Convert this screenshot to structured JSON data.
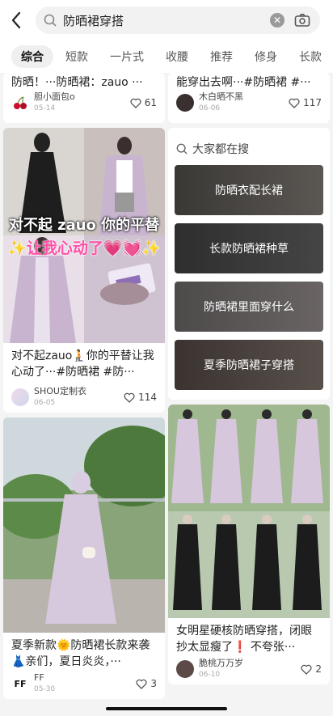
{
  "search": {
    "query": "防晒裙穿搭"
  },
  "tabs": [
    "综合",
    "短款",
    "一片式",
    "收腰",
    "推荐",
    "修身",
    "长款"
  ],
  "left_cards": [
    {
      "title": "防晒！···防晒裙：zauo ···",
      "author": "胆小面包o",
      "date": "05-14",
      "likes": "61"
    },
    {
      "title": "对不起zauo🧎你的平替让我心动了···#防晒裙 #防···",
      "author": "SHOU定制衣",
      "date": "06-05",
      "likes": "114",
      "overlay_line1": "对不起 zauo 你的平替",
      "overlay_line2": "✨让我心动了💗💓✨"
    },
    {
      "title": "夏季新款🌞防晒裙长款来袭👗亲们，夏日炎炎，···",
      "author": "FF",
      "date": "05-30",
      "likes": "3",
      "avatar_text": "FF"
    }
  ],
  "right_cards": [
    {
      "title": "能穿出去啊···#防晒裙 #···",
      "author": "木白晒不黑",
      "date": "06-06",
      "likes": "117"
    },
    {
      "title": "女明星硬核防晒穿搭，闭眼抄太显瘦了❗ 不夸张···",
      "author": "脆桃万万岁",
      "date": "06-10",
      "likes": "2"
    }
  ],
  "hot_searches": {
    "header": "大家都在搜",
    "items": [
      "防晒衣配长裙",
      "长款防晒裙种草",
      "防晒裙里面穿什么",
      "夏季防晒裙子穿搭"
    ]
  },
  "colors": {
    "accent": "#ff2442",
    "lavender": "#c8b4cf",
    "background": "#f4f4f4"
  }
}
